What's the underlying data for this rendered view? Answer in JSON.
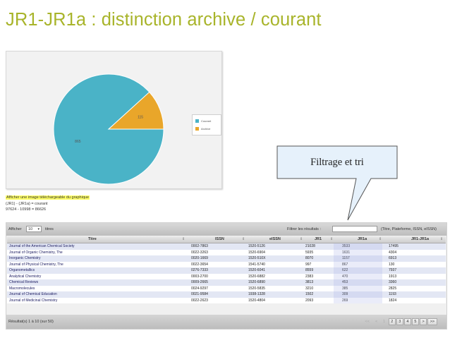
{
  "slide": {
    "title": "JR1-JR1a : distinction archive / courant"
  },
  "chart_data": {
    "type": "pie",
    "labels": [
      "Courant",
      "Archive"
    ],
    "values": [
      865,
      115
    ],
    "value_labels": [
      "865",
      "115"
    ],
    "colors": [
      "#4ab3c7",
      "#e9a62a"
    ],
    "legend": [
      "Courant",
      "Archive"
    ],
    "legend_position": "right"
  },
  "callout": {
    "text": "Filtrage et tri"
  },
  "info": {
    "link": "Afficher une image téléchargeable du graphique",
    "formula": "(JR1) - (JR1a) = courant",
    "calc": "97624 - 10998 = 86626"
  },
  "toolbar": {
    "show_label": "Afficher",
    "show_value": "10",
    "titles_label": "titres",
    "filter_label": "Filtrer les résultats :",
    "filter_placeholder": "",
    "filter_hint": "(Titre, Plateforme, ISSN, eISSN)"
  },
  "table": {
    "columns": [
      "Titre",
      "ISSN",
      "eISSN",
      "JR1",
      "JR1a",
      "JR1-JR1a"
    ],
    "rows": [
      [
        "Journal of the American Chemical Society",
        "0002-7863",
        "1520-5126",
        "21028",
        "3533",
        "17495"
      ],
      [
        "Journal of Organic Chemistry, The",
        "0022-3263",
        "1520-6904",
        "5935",
        "1631",
        "4304"
      ],
      [
        "Inorganic Chemistry",
        "0020-1669",
        "1520-510X",
        "8070",
        "1157",
        "6913"
      ],
      [
        "Journal of Physical Chemistry, The",
        "0022-3654",
        "1541-5740",
        "997",
        "867",
        "130"
      ],
      [
        "Organometallics",
        "0276-7333",
        "1520-6041",
        "8559",
        "622",
        "7937"
      ],
      [
        "Analytical Chemistry",
        "0003-2700",
        "1520-6882",
        "2383",
        "470",
        "1913"
      ],
      [
        "Chemical Reviews",
        "0009-2665",
        "1520-6890",
        "3813",
        "453",
        "3360"
      ],
      [
        "Macromolecules",
        "0024-9297",
        "1520-5835",
        "3210",
        "385",
        "2825"
      ],
      [
        "Journal of Chemical Education",
        "0021-9584",
        "1938-1328",
        "1502",
        "309",
        "1193"
      ],
      [
        "Journal of Medicinal Chemistry",
        "0022-2623",
        "1520-4804",
        "2093",
        "269",
        "1824"
      ]
    ]
  },
  "footer": {
    "results": "Résultat(s) 1 à 10 (sur 50)"
  },
  "pager": {
    "first": "<<",
    "prev": "<",
    "pages": [
      "1",
      "2",
      "3",
      "4",
      "5"
    ],
    "next": ">",
    "last": ">>"
  }
}
